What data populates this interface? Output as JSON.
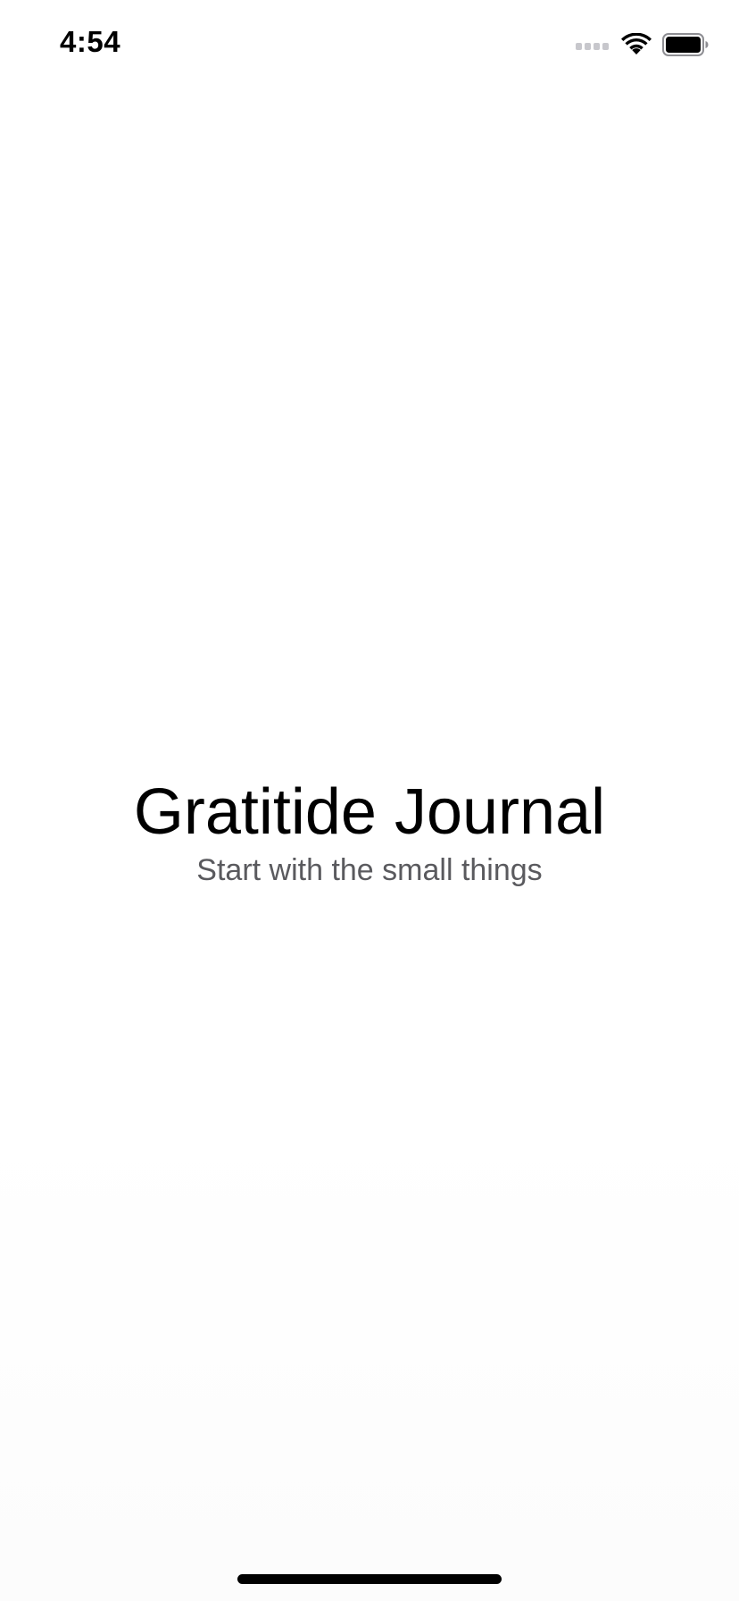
{
  "status_bar": {
    "time": "4:54",
    "signal_icon": "signal-strength-icon",
    "wifi_icon": "wifi-icon",
    "battery_icon": "battery-full-icon"
  },
  "main": {
    "title": "Gratitide Journal",
    "subtitle": "Start with the small things"
  },
  "colors": {
    "background": "#ffffff",
    "title_text": "#000000",
    "subtitle_text": "#5a5a5e",
    "signal_inactive": "#c7c7cc"
  }
}
